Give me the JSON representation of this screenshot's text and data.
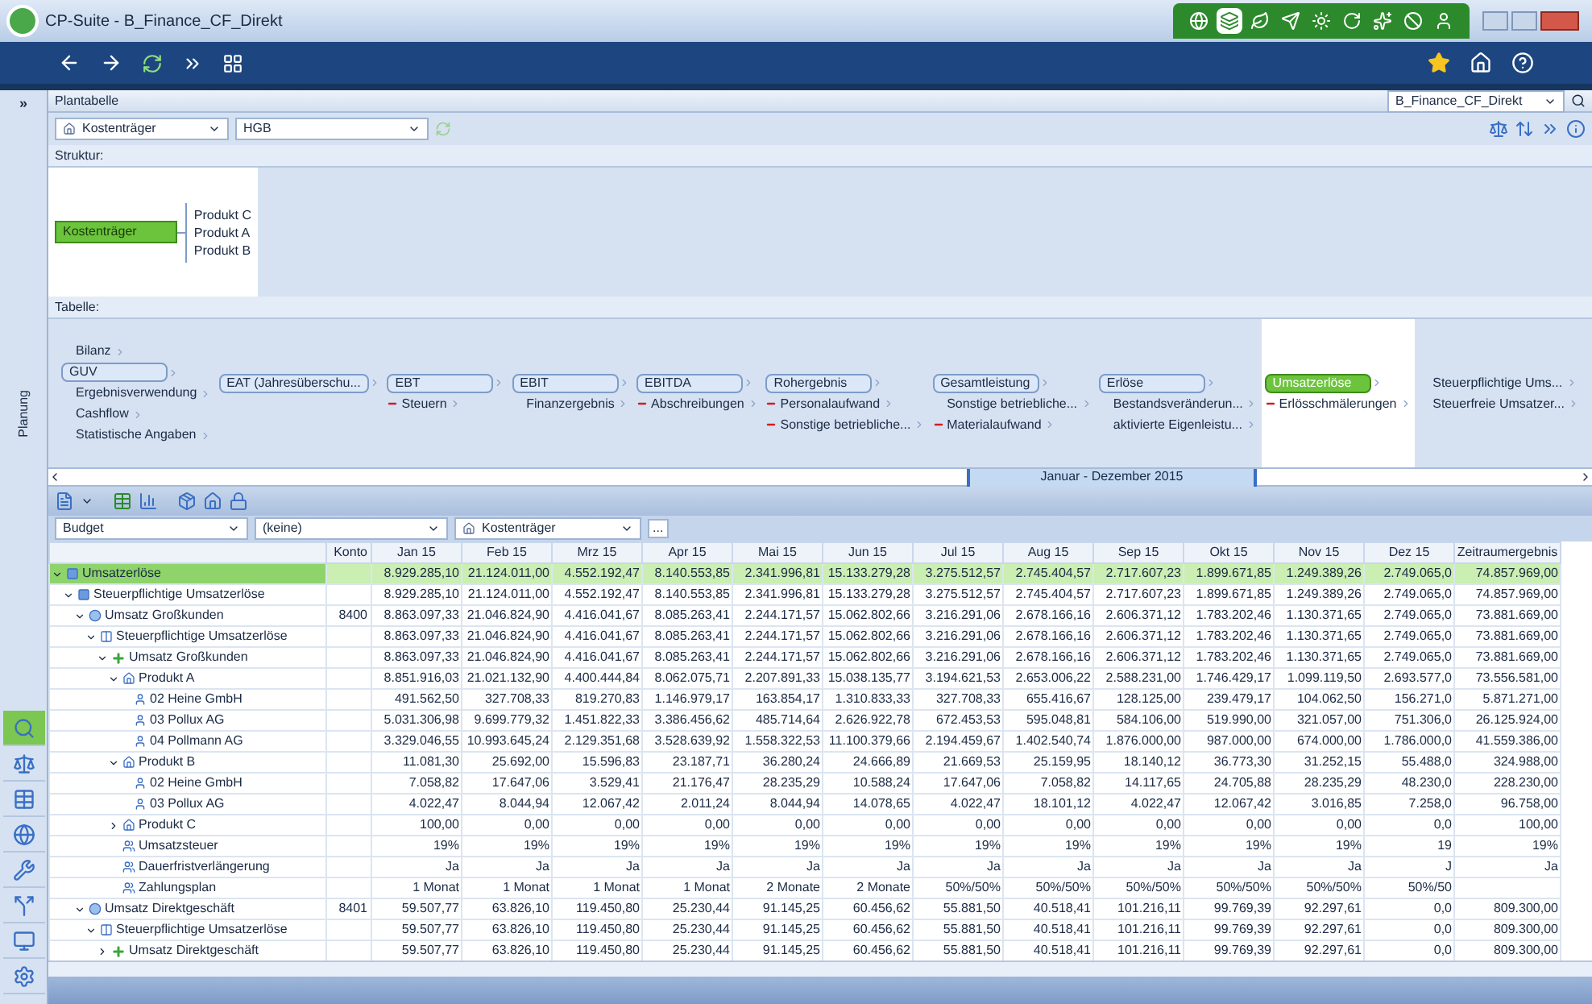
{
  "window": {
    "title": "CP-Suite - B_Finance_CF_Direkt"
  },
  "app_tools": [
    {
      "selected": false
    },
    {
      "selected": true
    },
    {
      "selected": false
    },
    {
      "selected": false
    },
    {
      "selected": false
    },
    {
      "selected": false
    },
    {
      "selected": false
    },
    {
      "selected": false
    },
    {
      "selected": false
    }
  ],
  "sidebar": {
    "expand": "»",
    "label": "Planung",
    "tools": [
      {
        "selected": true
      },
      {
        "selected": false
      },
      {
        "selected": false
      },
      {
        "selected": false
      },
      {
        "selected": false
      },
      {
        "selected": false
      },
      {
        "selected": false
      },
      {
        "selected": false
      }
    ]
  },
  "panel": {
    "title": "Plantabelle",
    "plan": "B_Finance_CF_Direkt"
  },
  "toolbar": {
    "dimension": "Kostenträger",
    "standard": "HGB"
  },
  "structure": {
    "header": "Struktur:",
    "root": "Kostenträger",
    "children": [
      "Produkt C",
      "Produkt A",
      "Produkt B"
    ]
  },
  "flow": {
    "header": "Tabelle:",
    "columns": [
      {
        "items": [
          {
            "label": "Bilanz",
            "kind": "plain"
          },
          {
            "label": "GUV",
            "kind": "box",
            "selected": false
          },
          {
            "label": "Ergebnisverwendung",
            "kind": "plain"
          },
          {
            "label": "Cashflow",
            "kind": "plain"
          },
          {
            "label": "Statistische Angaben",
            "kind": "plain"
          }
        ]
      },
      {
        "items": [
          {
            "label": "EAT (Jahresüberschu...",
            "kind": "box",
            "selected": false
          }
        ]
      },
      {
        "items": [
          {
            "label": "EBT",
            "kind": "box",
            "selected": false
          },
          {
            "label": "Steuern",
            "kind": "minus"
          }
        ]
      },
      {
        "items": [
          {
            "label": "EBIT",
            "kind": "box",
            "selected": false
          },
          {
            "label": "Finanzergebnis",
            "kind": "plus"
          }
        ]
      },
      {
        "items": [
          {
            "label": "EBITDA",
            "kind": "box",
            "selected": false
          },
          {
            "label": "Abschreibungen",
            "kind": "minus"
          }
        ]
      },
      {
        "items": [
          {
            "label": "Rohergebnis",
            "kind": "box",
            "selected": false
          },
          {
            "label": "Personalaufwand",
            "kind": "minus"
          },
          {
            "label": "Sonstige betriebliche...",
            "kind": "minus"
          }
        ]
      },
      {
        "items": [
          {
            "label": "Gesamtleistung",
            "kind": "box",
            "selected": false
          },
          {
            "label": "Sonstige betriebliche...",
            "kind": "plus"
          },
          {
            "label": "Materialaufwand",
            "kind": "minus"
          }
        ]
      },
      {
        "items": [
          {
            "label": "Erlöse",
            "kind": "box",
            "selected": false
          },
          {
            "label": "Bestandsveränderun...",
            "kind": "plus"
          },
          {
            "label": "aktivierte Eigenleistu...",
            "kind": "plus"
          }
        ]
      },
      {
        "items": [
          {
            "label": "Umsatzerlöse",
            "kind": "box",
            "selected": true
          },
          {
            "label": "Erlösschmälerungen",
            "kind": "minus"
          }
        ]
      },
      {
        "items": [
          {
            "label": "Steuerpflichtige Ums...",
            "kind": "plus"
          },
          {
            "label": "Steuerfreie Umsatzer...",
            "kind": "plus"
          }
        ]
      }
    ]
  },
  "timeline": {
    "range": "Januar - Dezember 2015"
  },
  "filters": {
    "scenario": "Budget",
    "version": "(keine)",
    "dimension": "Kostenträger",
    "more": "..."
  },
  "table": {
    "columns": [
      "Konto",
      "Jan 15",
      "Feb 15",
      "Mrz 15",
      "Apr 15",
      "Mai 15",
      "Jun 15",
      "Jul 15",
      "Aug 15",
      "Sep 15",
      "Okt 15",
      "Nov 15",
      "Dez 15",
      "Zeitraumergebnis"
    ],
    "rows": [
      {
        "name": "Umsatzerlöse",
        "kind": "folder",
        "expanded": true,
        "selected": true,
        "values": [
          "8.929.285,10",
          "21.124.011,00",
          "4.552.192,47",
          "8.140.553,85",
          "2.341.996,81",
          "15.133.279,28",
          "3.275.512,57",
          "2.745.404,57",
          "2.717.607,23",
          "1.899.671,85",
          "1.249.389,26",
          "2.749.065,0",
          "74.857.969,00"
        ],
        "children": [
          {
            "name": "Steuerpflichtige Umsatzerlöse",
            "kind": "folder",
            "expanded": true,
            "selected": false,
            "values": [
              "8.929.285,10",
              "21.124.011,00",
              "4.552.192,47",
              "8.140.553,85",
              "2.341.996,81",
              "15.133.279,28",
              "3.275.512,57",
              "2.745.404,57",
              "2.717.607,23",
              "1.899.671,85",
              "1.249.389,26",
              "2.749.065,0",
              "74.857.969,00"
            ],
            "children": [
              {
                "name": "Umsatz Großkunden",
                "konto": "8400",
                "kind": "account",
                "expanded": true,
                "selected": false,
                "values": [
                  "8.863.097,33",
                  "21.046.824,90",
                  "4.416.041,67",
                  "8.085.263,41",
                  "2.244.171,57",
                  "15.062.802,66",
                  "3.216.291,06",
                  "2.678.166,16",
                  "2.606.371,12",
                  "1.783.202,46",
                  "1.130.371,65",
                  "2.749.065,0",
                  "73.881.669,00"
                ],
                "children": [
                  {
                    "name": "Steuerpflichtige Umsatzerlöse",
                    "kind": "ledger",
                    "expanded": true,
                    "selected": false,
                    "values": [
                      "8.863.097,33",
                      "21.046.824,90",
                      "4.416.041,67",
                      "8.085.263,41",
                      "2.244.171,57",
                      "15.062.802,66",
                      "3.216.291,06",
                      "2.678.166,16",
                      "2.606.371,12",
                      "1.783.202,46",
                      "1.130.371,65",
                      "2.749.065,0",
                      "73.881.669,00"
                    ],
                    "children": [
                      {
                        "name": "Umsatz Großkunden",
                        "kind": "plus",
                        "expanded": true,
                        "selected": false,
                        "values": [
                          "8.863.097,33",
                          "21.046.824,90",
                          "4.416.041,67",
                          "8.085.263,41",
                          "2.244.171,57",
                          "15.062.802,66",
                          "3.216.291,06",
                          "2.678.166,16",
                          "2.606.371,12",
                          "1.783.202,46",
                          "1.130.371,65",
                          "2.749.065,0",
                          "73.881.669,00"
                        ],
                        "children": [
                          {
                            "name": "Produkt A",
                            "kind": "product",
                            "expanded": true,
                            "selected": false,
                            "values": [
                              "8.851.916,03",
                              "21.021.132,90",
                              "4.400.444,84",
                              "8.062.075,71",
                              "2.207.891,33",
                              "15.038.135,77",
                              "3.194.621,53",
                              "2.653.006,22",
                              "2.588.231,00",
                              "1.746.429,17",
                              "1.099.119,50",
                              "2.693.577,0",
                              "73.556.581,00"
                            ],
                            "children": [
                              {
                                "name": "02 Heine GmbH",
                                "kind": "customer",
                                "selected": false,
                                "values": [
                                  "491.562,50",
                                  "327.708,33",
                                  "819.270,83",
                                  "1.146.979,17",
                                  "163.854,17",
                                  "1.310.833,33",
                                  "327.708,33",
                                  "655.416,67",
                                  "128.125,00",
                                  "239.479,17",
                                  "104.062,50",
                                  "156.271,0",
                                  "5.871.271,00"
                                ]
                              },
                              {
                                "name": "03 Pollux AG",
                                "kind": "customer",
                                "selected": false,
                                "values": [
                                  "5.031.306,98",
                                  "9.699.779,32",
                                  "1.451.822,33",
                                  "3.386.456,62",
                                  "485.714,64",
                                  "2.626.922,78",
                                  "672.453,53",
                                  "595.048,81",
                                  "584.106,00",
                                  "519.990,00",
                                  "321.057,00",
                                  "751.306,0",
                                  "26.125.924,00"
                                ]
                              },
                              {
                                "name": "04 Pollmann AG",
                                "kind": "customer",
                                "selected": false,
                                "values": [
                                  "3.329.046,55",
                                  "10.993.645,24",
                                  "2.129.351,68",
                                  "3.528.639,92",
                                  "1.558.322,53",
                                  "11.100.379,66",
                                  "2.194.459,67",
                                  "1.402.540,74",
                                  "1.876.000,00",
                                  "987.000,00",
                                  "674.000,00",
                                  "1.786.000,0",
                                  "41.559.386,00"
                                ]
                              }
                            ]
                          },
                          {
                            "name": "Produkt B",
                            "kind": "product",
                            "expanded": true,
                            "selected": false,
                            "values": [
                              "11.081,30",
                              "25.692,00",
                              "15.596,83",
                              "23.187,71",
                              "36.280,24",
                              "24.666,89",
                              "21.669,53",
                              "25.159,95",
                              "18.140,12",
                              "36.773,30",
                              "31.252,15",
                              "55.488,0",
                              "324.988,00"
                            ],
                            "children": [
                              {
                                "name": "02 Heine GmbH",
                                "kind": "customer",
                                "selected": false,
                                "values": [
                                  "7.058,82",
                                  "17.647,06",
                                  "3.529,41",
                                  "21.176,47",
                                  "28.235,29",
                                  "10.588,24",
                                  "17.647,06",
                                  "7.058,82",
                                  "14.117,65",
                                  "24.705,88",
                                  "28.235,29",
                                  "48.230,0",
                                  "228.230,00"
                                ]
                              },
                              {
                                "name": "03 Pollux AG",
                                "kind": "customer",
                                "selected": false,
                                "values": [
                                  "4.022,47",
                                  "8.044,94",
                                  "12.067,42",
                                  "2.011,24",
                                  "8.044,94",
                                  "14.078,65",
                                  "4.022,47",
                                  "18.101,12",
                                  "4.022,47",
                                  "12.067,42",
                                  "3.016,85",
                                  "7.258,0",
                                  "96.758,00"
                                ]
                              }
                            ]
                          },
                          {
                            "name": "Produkt C",
                            "kind": "product",
                            "expanded": false,
                            "selected": false,
                            "values": [
                              "100,00",
                              "0,00",
                              "0,00",
                              "0,00",
                              "0,00",
                              "0,00",
                              "0,00",
                              "0,00",
                              "0,00",
                              "0,00",
                              "0,00",
                              "0,0",
                              "100,00"
                            ]
                          },
                          {
                            "name": "Umsatzsteuer",
                            "kind": "attribute",
                            "selected": false,
                            "values": [
                              "19%",
                              "19%",
                              "19%",
                              "19%",
                              "19%",
                              "19%",
                              "19%",
                              "19%",
                              "19%",
                              "19%",
                              "19%",
                              "19",
                              "19%"
                            ]
                          },
                          {
                            "name": "Dauerfristverlängerung",
                            "kind": "attribute",
                            "selected": false,
                            "values": [
                              "Ja",
                              "Ja",
                              "Ja",
                              "Ja",
                              "Ja",
                              "Ja",
                              "Ja",
                              "Ja",
                              "Ja",
                              "Ja",
                              "Ja",
                              "J",
                              "Ja"
                            ]
                          },
                          {
                            "name": "Zahlungsplan",
                            "kind": "attribute",
                            "selected": false,
                            "values": [
                              "1 Monat",
                              "1 Monat",
                              "1 Monat",
                              "1 Monat",
                              "2 Monate",
                              "2 Monate",
                              "50%/50%",
                              "50%/50%",
                              "50%/50%",
                              "50%/50%",
                              "50%/50%",
                              "50%/50"
                            ]
                          }
                        ]
                      }
                    ]
                  }
                ]
              },
              {
                "name": "Umsatz Direktgeschäft",
                "konto": "8401",
                "kind": "account",
                "expanded": true,
                "selected": false,
                "values": [
                  "59.507,77",
                  "63.826,10",
                  "119.450,80",
                  "25.230,44",
                  "91.145,25",
                  "60.456,62",
                  "55.881,50",
                  "40.518,41",
                  "101.216,11",
                  "99.769,39",
                  "92.297,61",
                  "0,0",
                  "809.300,00"
                ],
                "children": [
                  {
                    "name": "Steuerpflichtige Umsatzerlöse",
                    "kind": "ledger",
                    "expanded": true,
                    "selected": false,
                    "values": [
                      "59.507,77",
                      "63.826,10",
                      "119.450,80",
                      "25.230,44",
                      "91.145,25",
                      "60.456,62",
                      "55.881,50",
                      "40.518,41",
                      "101.216,11",
                      "99.769,39",
                      "92.297,61",
                      "0,0",
                      "809.300,00"
                    ],
                    "children": [
                      {
                        "name": "Umsatz Direktgeschäft",
                        "kind": "plus",
                        "expanded": false,
                        "selected": false,
                        "values": [
                          "59.507,77",
                          "63.826,10",
                          "119.450,80",
                          "25.230,44",
                          "91.145,25",
                          "60.456,62",
                          "55.881,50",
                          "40.518,41",
                          "101.216,11",
                          "99.769,39",
                          "92.297,61",
                          "0,0",
                          "809.300,00"
                        ]
                      }
                    ]
                  }
                ]
              }
            ]
          }
        ]
      }
    ]
  }
}
